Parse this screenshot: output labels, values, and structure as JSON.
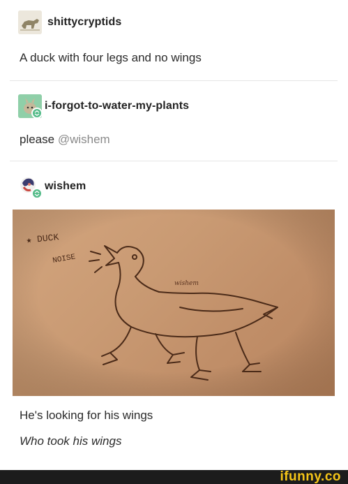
{
  "posts": [
    {
      "username": "shittycryptids",
      "text": "A duck with four legs and no wings"
    },
    {
      "username": "i-forgot-to-water-my-plants",
      "text_prefix": "please ",
      "mention": "@wishem"
    },
    {
      "username": "wishem",
      "sketch_text": {
        "line1": "★ DUCK",
        "line2": "NOISE",
        "signature": "wishem"
      },
      "captions": [
        "He's looking for his wings",
        "Who took his wings"
      ]
    }
  ],
  "brand": {
    "name": "ifunny.co",
    "color": "#f5c518"
  },
  "colors": {
    "reblog_badge": "#56bc8a",
    "paper": "#c99a73"
  }
}
